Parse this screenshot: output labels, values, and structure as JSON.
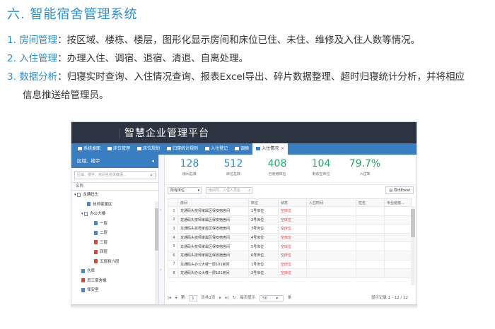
{
  "heading": "六. 智能宿舍管理系统",
  "bullets": [
    {
      "num": "1.",
      "key": "房间管理",
      "text": "：按区域、楼栋、楼层，图形化显示房间和床位已住、未住、维修及入住人数等情况。"
    },
    {
      "num": "2.",
      "key": "入住管理",
      "text": "：办理入住、调宿、退宿、清退、自离处理。"
    },
    {
      "num": "3.",
      "key": "数据分析",
      "text": "：归寝实时查询、入住情况查询、报表Excel导出、碎片数据整理、超时归寝统计分析，并将相应"
    }
  ],
  "bullet_cont": "信息推送给管理员。",
  "app": {
    "title": "智慧企业管理平台",
    "tabs": [
      {
        "label": "系统桌面",
        "active": false
      },
      {
        "label": "床位管理",
        "active": false
      },
      {
        "label": "床位规划",
        "active": false
      },
      {
        "label": "归寝统计规则",
        "active": false
      },
      {
        "label": "入住登记",
        "active": false
      },
      {
        "label": "调换",
        "active": false
      },
      {
        "label": "入住情况",
        "active": true
      }
    ],
    "sidebar": {
      "header": "区域、楼宇",
      "search_placeholder": "区域、楼宇、房间名称关键语...",
      "col_header": "名称",
      "tree": [
        {
          "label": "龙通码头",
          "indent": 0,
          "icon": "folder-icon",
          "color": "folder"
        },
        {
          "label": "技师家属区",
          "indent": 2,
          "icon": "building-icon",
          "color": "blue"
        },
        {
          "label": "办公大楼",
          "indent": 1,
          "icon": "folder-icon",
          "color": "folder"
        },
        {
          "label": "一层",
          "indent": 3,
          "icon": "floor-icon",
          "color": "blue"
        },
        {
          "label": "二层",
          "indent": 3,
          "icon": "floor-icon",
          "color": "blue"
        },
        {
          "label": "三层",
          "indent": 3,
          "icon": "floor-icon",
          "color": "red"
        },
        {
          "label": "四层",
          "indent": 3,
          "icon": "floor-icon",
          "color": "red"
        },
        {
          "label": "五层和六层",
          "indent": 3,
          "icon": "floor-icon",
          "color": "red"
        },
        {
          "label": "仓库",
          "indent": 1,
          "icon": "building-icon",
          "color": "blue"
        },
        {
          "label": "员工宿舍楼",
          "indent": 1,
          "icon": "building-icon",
          "color": "red"
        },
        {
          "label": "保安室",
          "indent": 1,
          "icon": "building-icon",
          "color": "blue"
        }
      ]
    },
    "stats": [
      {
        "value": "128",
        "label": "房间总数",
        "color": "#2b8fd0"
      },
      {
        "value": "512",
        "label": "床位总数",
        "color": "#2b8fd0"
      },
      {
        "value": "408",
        "label": "已使用床位",
        "color": "#2aa56b"
      },
      {
        "value": "104",
        "label": "剩余空床位",
        "color": "#2aa56b"
      },
      {
        "value": "79.7%",
        "label": "入住率",
        "color": "#2aa56b"
      }
    ],
    "filter": {
      "bed_select": "所有床位",
      "keyword_placeholder": "房间号、入住人员名",
      "excel_label": "导出Excel"
    },
    "table": {
      "headers": [
        "",
        "房间",
        "床位",
        "状态",
        "入住时间",
        "姓名",
        "专业班级..."
      ],
      "rows": [
        {
          "idx": "1",
          "room": "龙通码头技师家属区保安宿舍间",
          "bed": "1号床位",
          "status": "空床位"
        },
        {
          "idx": "2",
          "room": "龙通码头技师家属区保安宿舍间",
          "bed": "2号床位",
          "status": "空床位"
        },
        {
          "idx": "3",
          "room": "龙通码头技师家属区保安宿舍间",
          "bed": "3号床位",
          "status": "空床位"
        },
        {
          "idx": "4",
          "room": "龙通码头技师家属区保安宿舍间",
          "bed": "4号床位",
          "status": "空床位"
        },
        {
          "idx": "5",
          "room": "龙通码头技师家属区保安宿舍间",
          "bed": "5号床位",
          "status": "空床位"
        },
        {
          "idx": "6",
          "room": "龙通码头技师家属区保安宿舍间",
          "bed": "6号床位",
          "status": "空床位"
        },
        {
          "idx": "7",
          "room": "龙通码头办公大楼一层101房间",
          "bed": "1号床位",
          "status": "空床位"
        },
        {
          "idx": "8",
          "room": "龙通码头办公大楼一层101房间",
          "bed": "2号床位",
          "status": "空床位"
        }
      ]
    },
    "pager": {
      "page_label": "第",
      "page_value": "1",
      "of_label": "页共1页",
      "per_page_label": "每页显示",
      "per_page_value": "50",
      "unit_label": "条",
      "info": "显示记录 1 - 12 / 12"
    }
  }
}
